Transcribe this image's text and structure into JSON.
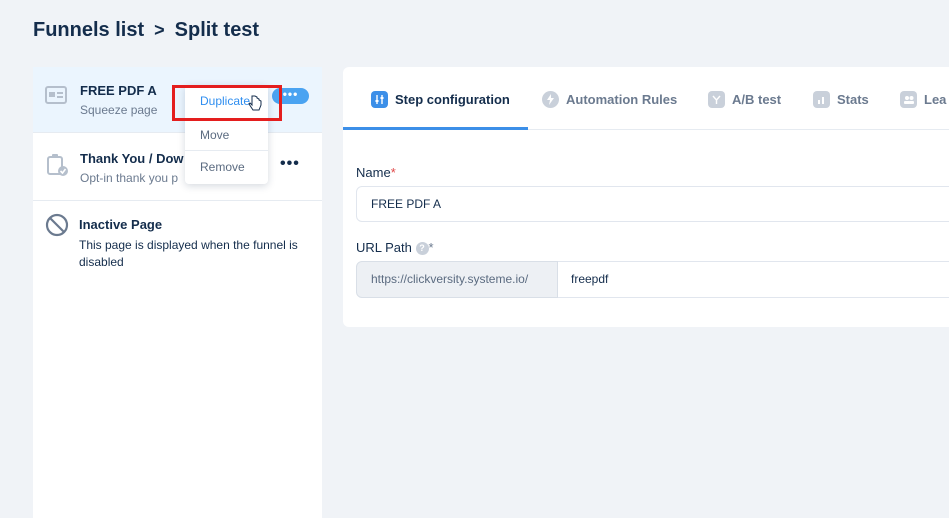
{
  "breadcrumb": {
    "parent": "Funnels list",
    "separator": ">",
    "current": "Split test"
  },
  "steps": [
    {
      "title": "FREE PDF A",
      "subtitle": "Squeeze page",
      "more": "•••",
      "icon": "page-icon"
    },
    {
      "title": "Thank You / Dow",
      "subtitle": "Opt-in thank you p",
      "more": "•••",
      "icon": "clipboard-check-icon"
    },
    {
      "title": "Inactive Page",
      "description": "This page is displayed when the funnel is disabled",
      "icon": "ban-icon"
    }
  ],
  "dropdown": {
    "items": [
      "Duplicate",
      "Move",
      "Remove"
    ]
  },
  "tabs": [
    {
      "label": "Step configuration",
      "icon": "sliders-icon",
      "active": true
    },
    {
      "label": "Automation Rules",
      "icon": "bolt-icon"
    },
    {
      "label": "A/B test",
      "icon": "split-icon"
    },
    {
      "label": "Stats",
      "icon": "bar-chart-icon"
    },
    {
      "label": "Lea",
      "icon": "users-icon"
    }
  ],
  "form": {
    "name_label": "Name",
    "required_mark": "*",
    "name_value": "FREE PDF A",
    "url_label": "URL Path",
    "help_mark": "?",
    "url_prefix": "https://clickversity.systeme.io/",
    "url_value": "freepdf"
  },
  "colors": {
    "accent": "#3c8fe8",
    "highlight": "#e41e1e",
    "active_row": "#ebf5fe"
  }
}
